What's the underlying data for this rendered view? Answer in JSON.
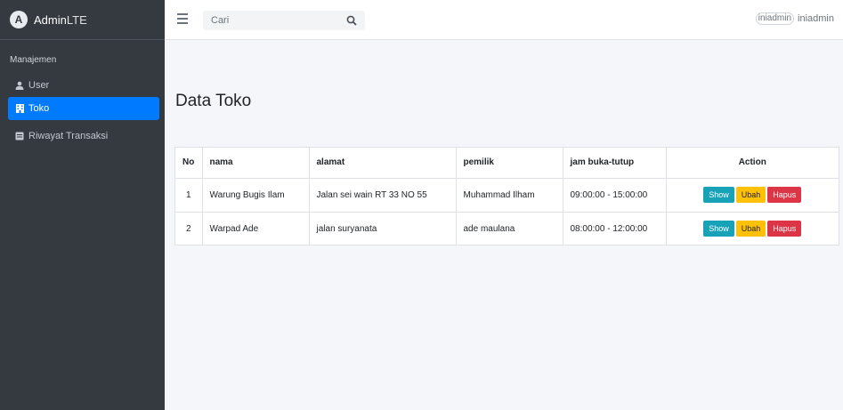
{
  "sidebar": {
    "brand_logo_letter": "A",
    "brand_bold": "Admin",
    "brand_light": "LTE",
    "section_header": "Manajemen",
    "items": [
      {
        "label": "User",
        "icon": "user-icon"
      },
      {
        "label": "Toko",
        "icon": "building-icon"
      },
      {
        "label": "Riwayat Transaksi",
        "icon": "book-icon"
      }
    ]
  },
  "navbar": {
    "search_placeholder": "Cari",
    "user_image_alt": "iniadmin",
    "user_name": "iniadmin"
  },
  "main": {
    "page_title": "Data Toko",
    "table": {
      "headers": [
        "No",
        "nama",
        "alamat",
        "pemilik",
        "jam buka-tutup",
        "Action"
      ],
      "rows": [
        [
          "1",
          "Warung Bugis Ilam",
          "Jalan sei wain RT 33 NO 55",
          "Muhammad Ilham",
          "09:00:00 - 15:00:00"
        ],
        [
          "2",
          "Warpad Ade",
          "jalan suryanata",
          "ade maulana",
          "08:00:00 - 12:00:00"
        ]
      ],
      "actions": {
        "show": "Show",
        "ubah": "Ubah",
        "hapus": "Hapus"
      }
    }
  },
  "colors": {
    "sidebar_bg": "#343a40",
    "active": "#007bff",
    "show": "#17a2b8",
    "ubah": "#ffc107",
    "hapus": "#dc3545"
  }
}
